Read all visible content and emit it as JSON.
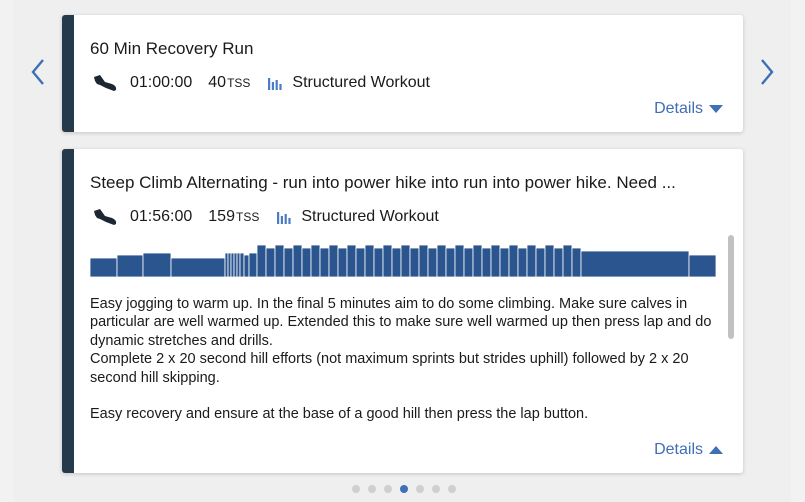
{
  "colors": {
    "accent": "#3f6fb5",
    "card_stripe": "#253a4a",
    "graph_bar": "#2b558f"
  },
  "nav": {
    "prev_icon": "chevron-left-icon",
    "next_icon": "chevron-right-icon"
  },
  "cards": [
    {
      "title": "60 Min Recovery Run",
      "sport_icon": "run-shoe-icon",
      "duration": "01:00:00",
      "tss_value": "40",
      "tss_unit": "TSS",
      "type_icon": "bar-chart-icon",
      "workout_type": "Structured Workout",
      "details_label": "Details",
      "expanded": false
    },
    {
      "title": "Steep Climb Alternating - run into power hike into run into power hike. Need ...",
      "sport_icon": "run-shoe-icon",
      "duration": "01:56:00",
      "tss_value": "159",
      "tss_unit": "TSS",
      "type_icon": "bar-chart-icon",
      "workout_type": "Structured Workout",
      "details_label": "Details",
      "expanded": true,
      "description": {
        "p1": "Easy jogging to warm up. In the final 5 minutes aim to do some climbing. Make sure calves in particular are well warmed up. Extended this to make sure well warmed up then press lap and do dynamic stretches and drills.",
        "p2": "Complete 2 x 20 second hill efforts (not maximum sprints but strides uphill) followed by 2 x 20 second hill skipping.",
        "p3": "Easy recovery and ensure at the base of a good hill then press the lap button."
      }
    }
  ],
  "pagination": {
    "total": 7,
    "active_index": 3
  }
}
